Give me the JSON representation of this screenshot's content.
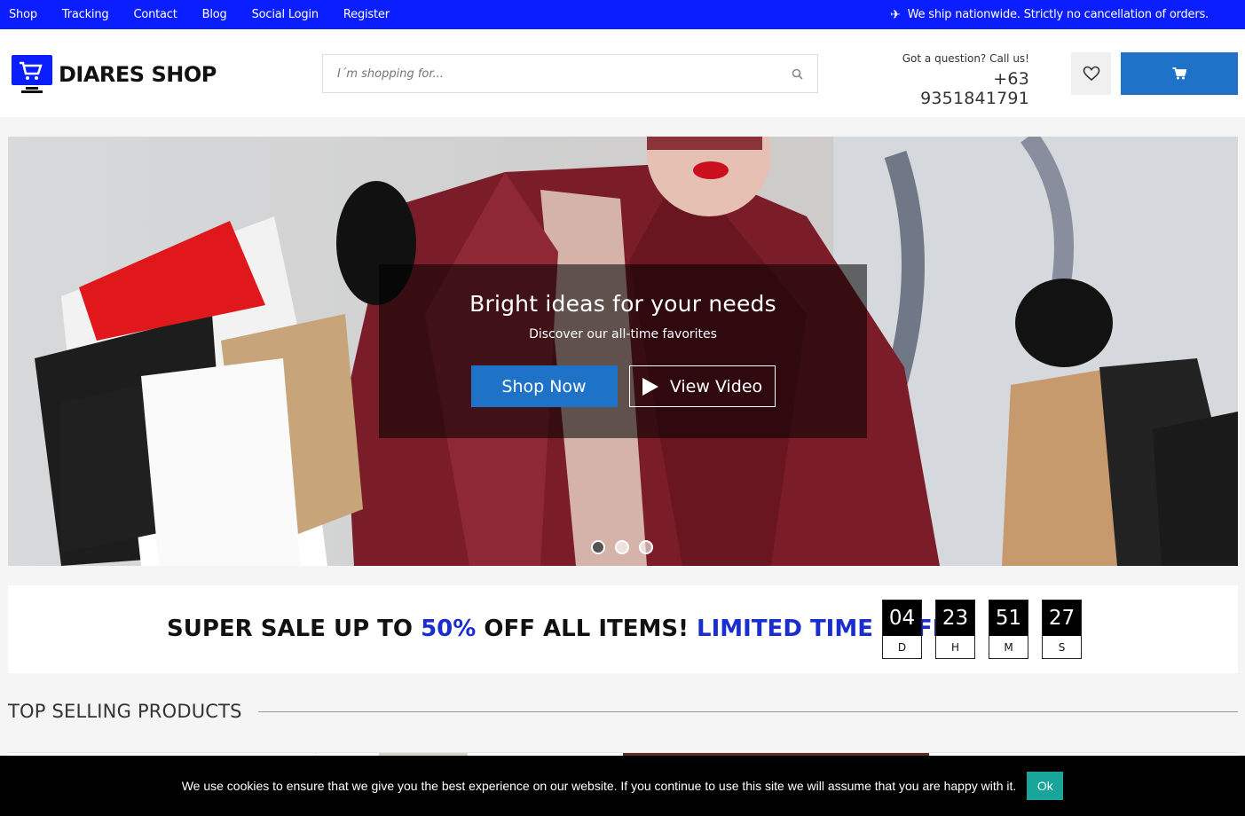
{
  "topbar": {
    "nav": [
      "Shop",
      "Tracking",
      "Contact",
      "Blog",
      "Social Login",
      "Register"
    ],
    "ship_note": "We ship nationwide. Strictly no cancellation of orders.",
    "bg_color": "#0b1eff"
  },
  "header": {
    "logo_text": "DIARES SHOP",
    "search_placeholder": "I´m shopping for...",
    "contact_question": "Got a question? Call us!",
    "contact_phone": "+63 9351841791",
    "accent_color": "#1e73c8"
  },
  "hero": {
    "title": "Bright ideas for your needs",
    "subtitle": "Discover our all-time favorites",
    "shop_button": "Shop Now",
    "video_button": "View Video",
    "slide_count": 3,
    "active_slide": 1
  },
  "sale": {
    "part1": "SUPER SALE UP TO ",
    "highlight": "50%",
    "part2": " OFF ALL ITEMS! ",
    "offer": "LIMITED TIME OFFER",
    "countdown": [
      {
        "value": "04",
        "label": "D"
      },
      {
        "value": "23",
        "label": "H"
      },
      {
        "value": "51",
        "label": "M"
      },
      {
        "value": "27",
        "label": "S"
      }
    ]
  },
  "section": {
    "top_selling": "TOP SELLING PRODUCTS"
  },
  "cookie": {
    "message": "We use cookies to ensure that we give you the best experience on our website. If you continue to use this site we will assume that you are happy with it.",
    "ok_label": "Ok"
  }
}
